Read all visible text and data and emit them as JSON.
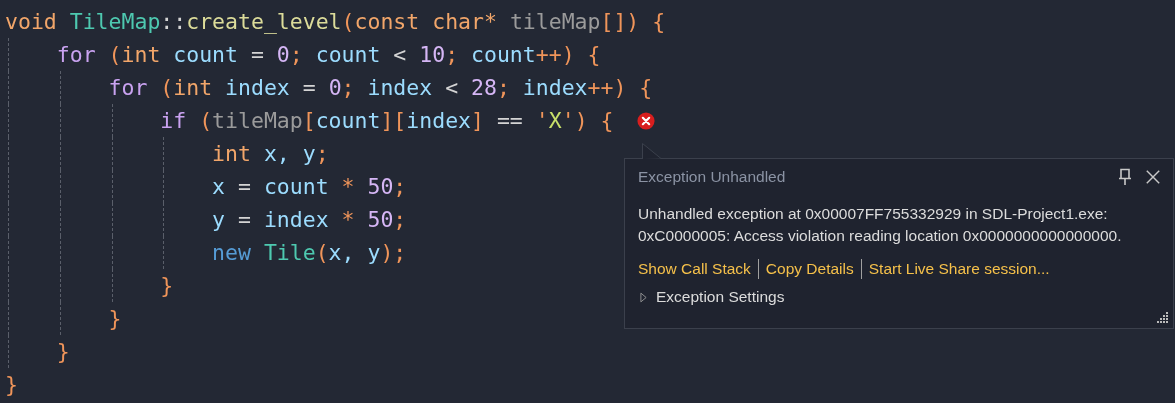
{
  "editor": {
    "lines": [
      {
        "tokens": [
          {
            "text": "void ",
            "kind": "keyword"
          },
          {
            "text": "TileMap",
            "kind": "type"
          },
          {
            "text": "::",
            "kind": "plain"
          },
          {
            "text": "create_level",
            "kind": "function"
          },
          {
            "text": "(",
            "kind": "punct"
          },
          {
            "text": "const char* ",
            "kind": "keyword"
          },
          {
            "text": "tileMap",
            "kind": "param"
          },
          {
            "text": "[]) {",
            "kind": "punct"
          }
        ],
        "error": false,
        "children": [
          {
            "tokens": [
              {
                "text": "for",
                "kind": "control"
              },
              {
                "text": " (",
                "kind": "punct"
              },
              {
                "text": "int",
                "kind": "keyword"
              },
              {
                "text": " count ",
                "kind": "variable"
              },
              {
                "text": "= ",
                "kind": "plain"
              },
              {
                "text": "0",
                "kind": "number"
              },
              {
                "text": "; ",
                "kind": "punct"
              },
              {
                "text": "count ",
                "kind": "variable"
              },
              {
                "text": "< ",
                "kind": "plain"
              },
              {
                "text": "10",
                "kind": "number"
              },
              {
                "text": "; ",
                "kind": "punct"
              },
              {
                "text": "count",
                "kind": "variable"
              },
              {
                "text": "++) {",
                "kind": "punct"
              }
            ],
            "error": false,
            "children": [
              {
                "tokens": [
                  {
                    "text": "for",
                    "kind": "control"
                  },
                  {
                    "text": " (",
                    "kind": "punct"
                  },
                  {
                    "text": "int",
                    "kind": "keyword"
                  },
                  {
                    "text": " index ",
                    "kind": "variable"
                  },
                  {
                    "text": "= ",
                    "kind": "plain"
                  },
                  {
                    "text": "0",
                    "kind": "number"
                  },
                  {
                    "text": "; ",
                    "kind": "punct"
                  },
                  {
                    "text": "index ",
                    "kind": "variable"
                  },
                  {
                    "text": "< ",
                    "kind": "plain"
                  },
                  {
                    "text": "28",
                    "kind": "number"
                  },
                  {
                    "text": "; ",
                    "kind": "punct"
                  },
                  {
                    "text": "index",
                    "kind": "variable"
                  },
                  {
                    "text": "++) {",
                    "kind": "punct"
                  }
                ],
                "error": false,
                "children": [
                  {
                    "tokens": [
                      {
                        "text": "if",
                        "kind": "control"
                      },
                      {
                        "text": " (",
                        "kind": "punct"
                      },
                      {
                        "text": "tileMap",
                        "kind": "param"
                      },
                      {
                        "text": "[",
                        "kind": "punct"
                      },
                      {
                        "text": "count",
                        "kind": "variable"
                      },
                      {
                        "text": "][",
                        "kind": "punct"
                      },
                      {
                        "text": "index",
                        "kind": "variable"
                      },
                      {
                        "text": "] ",
                        "kind": "punct"
                      },
                      {
                        "text": "== ",
                        "kind": "plain"
                      },
                      {
                        "text": "'",
                        "kind": "punct"
                      },
                      {
                        "text": "X",
                        "kind": "string"
                      },
                      {
                        "text": "'",
                        "kind": "punct"
                      },
                      {
                        "text": ") {",
                        "kind": "punct"
                      }
                    ],
                    "error": true,
                    "children": [
                      {
                        "tokens": [
                          {
                            "text": "int",
                            "kind": "keyword"
                          },
                          {
                            "text": " x, y",
                            "kind": "variable"
                          },
                          {
                            "text": ";",
                            "kind": "punct"
                          }
                        ],
                        "error": false
                      },
                      {
                        "tokens": [
                          {
                            "text": "x ",
                            "kind": "variable"
                          },
                          {
                            "text": "= ",
                            "kind": "plain"
                          },
                          {
                            "text": "count ",
                            "kind": "variable"
                          },
                          {
                            "text": "* ",
                            "kind": "punct"
                          },
                          {
                            "text": "50",
                            "kind": "number"
                          },
                          {
                            "text": ";",
                            "kind": "punct"
                          }
                        ],
                        "error": false
                      },
                      {
                        "tokens": [
                          {
                            "text": "y ",
                            "kind": "variable"
                          },
                          {
                            "text": "= ",
                            "kind": "plain"
                          },
                          {
                            "text": "index ",
                            "kind": "variable"
                          },
                          {
                            "text": "* ",
                            "kind": "punct"
                          },
                          {
                            "text": "50",
                            "kind": "number"
                          },
                          {
                            "text": ";",
                            "kind": "punct"
                          }
                        ],
                        "error": false
                      },
                      {
                        "tokens": [
                          {
                            "text": "new ",
                            "kind": "new"
                          },
                          {
                            "text": "Tile",
                            "kind": "type"
                          },
                          {
                            "text": "(",
                            "kind": "punct"
                          },
                          {
                            "text": "x, y",
                            "kind": "variable"
                          },
                          {
                            "text": ");",
                            "kind": "punct"
                          }
                        ],
                        "error": false
                      }
                    ]
                  },
                  {
                    "tokens": [
                      {
                        "text": "}",
                        "kind": "punct"
                      }
                    ],
                    "error": false
                  }
                ]
              },
              {
                "tokens": [
                  {
                    "text": "}",
                    "kind": "punct"
                  }
                ],
                "error": false
              }
            ]
          },
          {
            "tokens": [
              {
                "text": "}",
                "kind": "punct"
              }
            ],
            "error": false
          }
        ]
      },
      {
        "tokens": [
          {
            "text": "}",
            "kind": "punct"
          }
        ],
        "error": false
      }
    ]
  },
  "exception_popup": {
    "title": "Exception Unhandled",
    "message": "Unhandled exception at 0x00007FF755332929 in SDL-Project1.exe: 0xC0000005: Access violation reading location 0x0000000000000000.",
    "links": [
      "Show Call Stack",
      "Copy Details",
      "Start Live Share session..."
    ],
    "settings": {
      "label": "Exception Settings",
      "expanded": false
    }
  }
}
